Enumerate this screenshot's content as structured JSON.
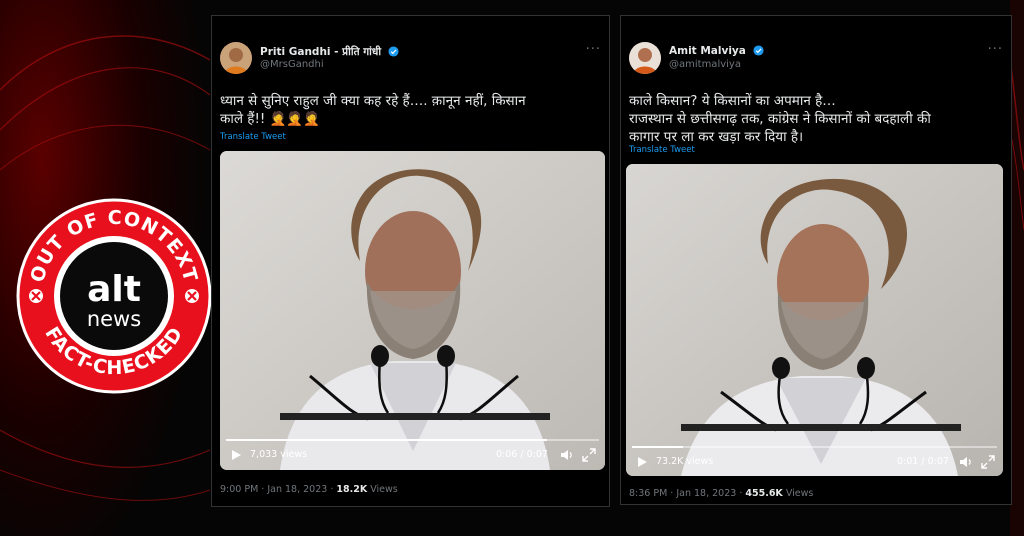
{
  "colors": {
    "twitter_blue": "#1d9bf0",
    "badge_red": "#e8101c",
    "background": "#050505"
  },
  "badge": {
    "top_text": "OUT OF CONTEXT",
    "bottom_text": "FACT-CHECKED",
    "logo_text_1": "alt",
    "logo_text_2": "news"
  },
  "tweets": [
    {
      "display_name": "Priti Gandhi - प्रीति गांधी",
      "handle": "@MrsGandhi",
      "body_line_1": "ध्यान से सुनिए राहुल जी क्या कह रहे हैं…. क़ानून नहीं, किसान",
      "body_line_2": "काले हैं!! 🤦🤦🤦",
      "translate": "Translate Tweet",
      "views_overlay": "7,033 views",
      "time": "0:06 / 0:07",
      "progress": 0.86,
      "timestamp": "9:00 PM · Jan 18, 2023 · ",
      "views_count": "18.2K",
      "views_label": " Views"
    },
    {
      "display_name": "Amit Malviya",
      "handle": "@amitmalviya",
      "body_line_1": "काले किसान? ये किसानों का अपमान है…",
      "body_line_2": "राजस्थान से छत्तीसगढ़ तक, कांग्रेस ने किसानों को बदहाली की",
      "body_line_3": "कागार पर ला कर खड़ा कर दिया है।",
      "translate": "Translate Tweet",
      "views_overlay": "73.2K views",
      "time": "0:01 / 0:07",
      "progress": 0.14,
      "timestamp": "8:36 PM · Jan 18, 2023 · ",
      "views_count": "455.6K",
      "views_label": " Views"
    }
  ]
}
